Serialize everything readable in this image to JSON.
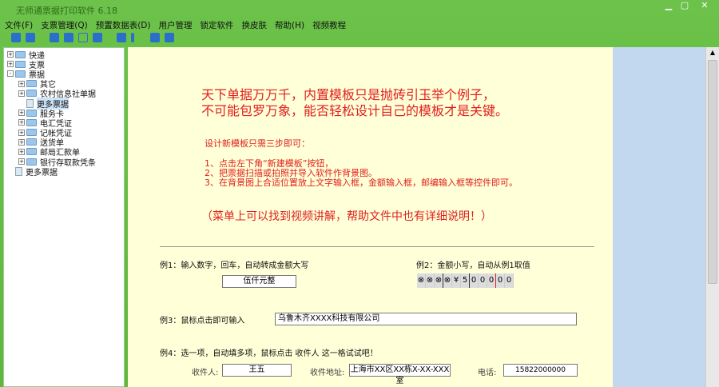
{
  "window": {
    "title": "无师通票据打印软件 6.18",
    "min": "▁",
    "max": "▢",
    "close": "✕"
  },
  "menu": [
    "文件(F)",
    "支票管理(Q)",
    "预置数据表(D)",
    "用户管理",
    "锁定软件",
    "换皮肤",
    "帮助(H)",
    "视频教程"
  ],
  "tree": [
    {
      "label": "快递",
      "level": 0,
      "type": "folder",
      "exp": "+"
    },
    {
      "label": "支票",
      "level": 0,
      "type": "folder",
      "exp": "+"
    },
    {
      "label": "票据",
      "level": 0,
      "type": "folder",
      "exp": "-"
    },
    {
      "label": "其它",
      "level": 1,
      "type": "folder",
      "exp": "+"
    },
    {
      "label": "农村信息社单据",
      "level": 1,
      "type": "folder",
      "exp": "+"
    },
    {
      "label": "更多票据",
      "level": 1,
      "type": "doc",
      "selected": true
    },
    {
      "label": "服务卡",
      "level": 1,
      "type": "folder",
      "exp": "+"
    },
    {
      "label": "电汇凭证",
      "level": 1,
      "type": "folder",
      "exp": "+"
    },
    {
      "label": "记帐凭证",
      "level": 1,
      "type": "folder",
      "exp": "+"
    },
    {
      "label": "送货单",
      "level": 1,
      "type": "folder",
      "exp": "+"
    },
    {
      "label": "邮局汇款单",
      "level": 1,
      "type": "folder",
      "exp": "+"
    },
    {
      "label": "银行存取款凭条",
      "level": 1,
      "type": "folder",
      "exp": "+"
    },
    {
      "label": "更多票据",
      "level": 0,
      "type": "doc"
    }
  ],
  "main": {
    "headline1": "天下单据万万千，内置模板只是抛砖引玉举个例子，",
    "headline2": "不可能包罗万象，能否轻松设计自己的模板才是关键。",
    "steps_title": "设计新模板只需三步即可：",
    "step1": "1、点击左下角“新建模板”按钮，",
    "step2": "2、把票据扫描或拍照并导入软件作背景图。",
    "step3": "3、在背景图上合适位置放上文字输入框，金额输入框，邮编输入框等控件即可。",
    "note": "（菜单上可以找到视频讲解，帮助文件中也有详细说明！）",
    "ex1_label": "例1：输入数字，回车，自动转成金额大写",
    "ex1_value": "伍仟元整",
    "ex2_label": "例2：金额小写，自动从例1取值",
    "ex2_cells": [
      "⊗",
      "⊗",
      "⊗",
      "⊗",
      "¥",
      "5",
      "0",
      "0",
      "0",
      "0",
      "0"
    ],
    "ex3_label": "例3：鼠标点击即可输入",
    "ex3_value": "乌鲁木齐XXXX科技有限公司",
    "ex4_label": "例4：选一项，自动填多项，鼠标点击 收件人 这一格试试吧！",
    "recipient_label": "收件人:",
    "recipient_value": "王五",
    "address_label": "收件地址:",
    "address_value": "上海市XX区XX栋X-XX-XXX室",
    "phone_label": "电话:",
    "phone_value": "15822000000"
  }
}
